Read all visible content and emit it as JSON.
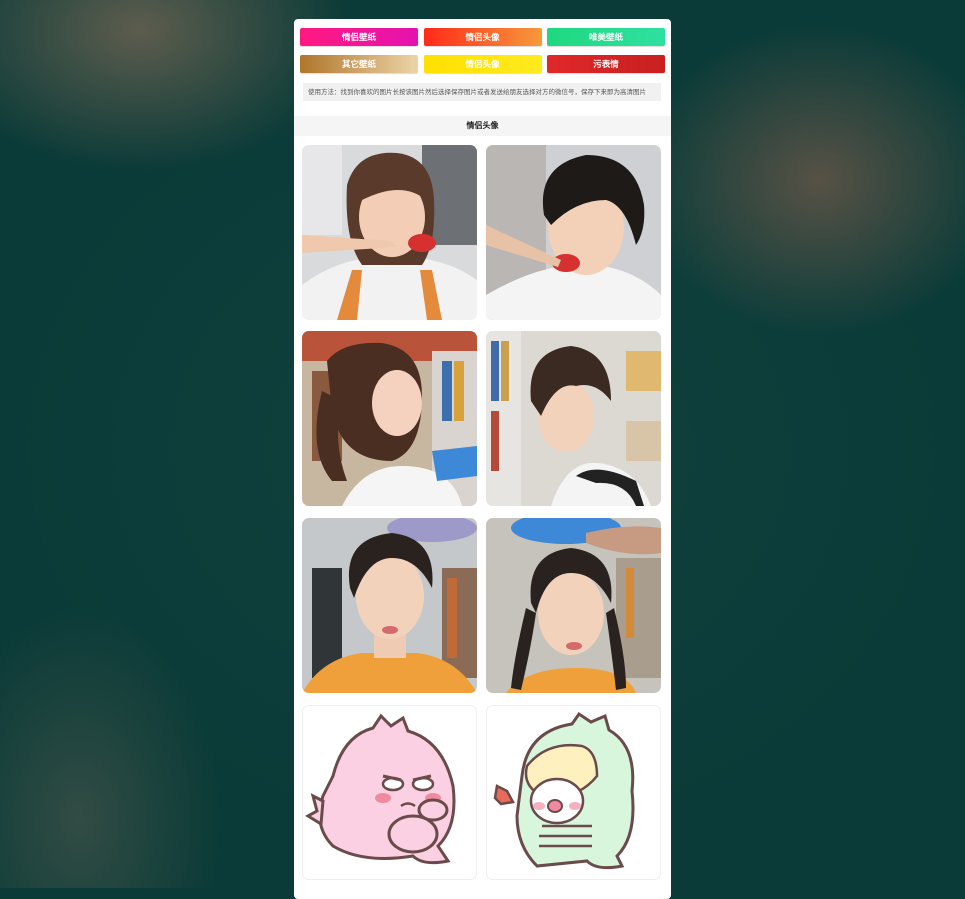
{
  "buttons": [
    {
      "label": "情侣壁纸",
      "bg": "linear-gradient(90deg,#ff1a80,#e512b0)"
    },
    {
      "label": "情侣头像",
      "bg": "linear-gradient(90deg,#ff2a1a,#f59a3a)"
    },
    {
      "label": "唯美壁纸",
      "bg": "linear-gradient(90deg,#20d880,#2ee0a0)"
    },
    {
      "label": "其它壁纸",
      "bg": "linear-gradient(90deg,#b0762a,#ecd4a8)"
    },
    {
      "label": "情侣头像",
      "bg": "linear-gradient(90deg,#ffe000,#ffea20)"
    },
    {
      "label": "污表情",
      "bg": "linear-gradient(90deg,#e0282a,#c82020)"
    }
  ],
  "usage_text": "使用方法：找到你喜欢的图片长按该图片然后选择保存图片或者发送给朋友选择对方的微信号，保存下来即为高清图片",
  "section_title": "情侣头像",
  "thumbnails": [
    {
      "name": "avatar-girl-eating"
    },
    {
      "name": "avatar-boy-eating"
    },
    {
      "name": "avatar-girl-library"
    },
    {
      "name": "avatar-boy-library"
    },
    {
      "name": "avatar-boy-bowl"
    },
    {
      "name": "avatar-girl-bowl"
    },
    {
      "name": "avatar-pink-dino"
    },
    {
      "name": "avatar-green-dino"
    }
  ]
}
